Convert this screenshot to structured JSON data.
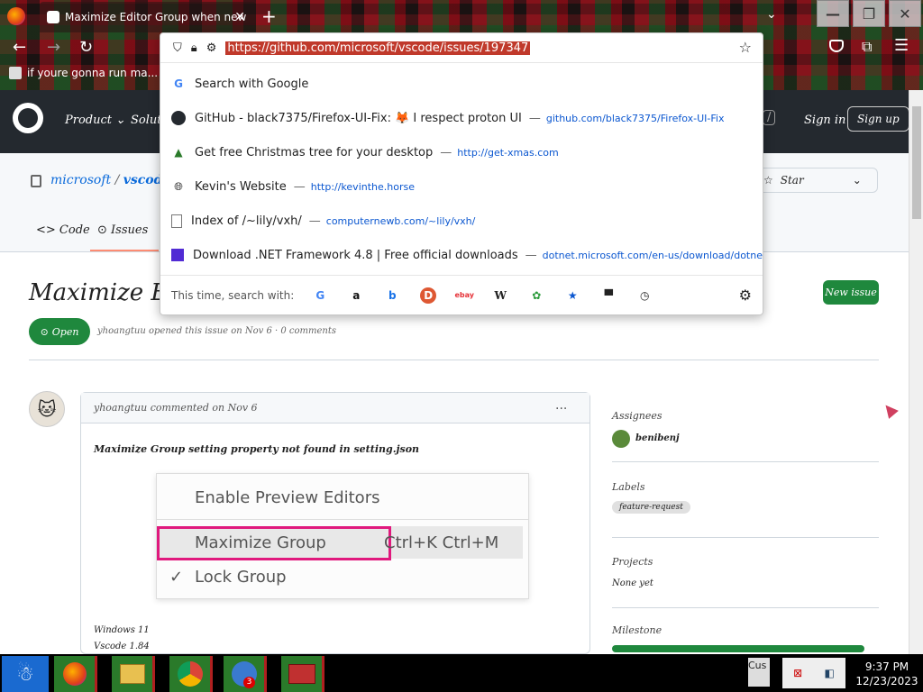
{
  "browser": {
    "tab_title": "Maximize Editor Group when new",
    "tab_close": "✕",
    "new_tab": "+",
    "url_full": "https://github.com/microsoft/vscode/issues/197347",
    "bookmark_label": "if youre gonna run ma...",
    "window_controls": [
      "—",
      "❐",
      "✕"
    ]
  },
  "urlbar_dropdown": {
    "suggestions": [
      {
        "title": "Search with Google",
        "url": "",
        "icon": "google-icon"
      },
      {
        "title": "GitHub - black7375/Firefox-UI-Fix: 🦊 I respect proton UI",
        "url": "github.com/black7375/Firefox-UI-Fix",
        "icon": "github-icon"
      },
      {
        "title": "Get free Christmas tree for your desktop",
        "url": "http://get-xmas.com",
        "icon": "tree-icon"
      },
      {
        "title": "Kevin's Website",
        "url": "http://kevinthe.horse",
        "icon": "globe-icon"
      },
      {
        "title": "Index of /~lily/vxh/",
        "url": "computernewb.com/~lily/vxh/",
        "icon": "page-icon"
      },
      {
        "title": "Download .NET Framework 4.8 | Free official downloads",
        "url": "dotnet.microsoft.com/en-us/download/dotnet-f",
        "icon": "dotnet-icon"
      }
    ],
    "search_label": "This time, search with:",
    "engines": [
      "G",
      "a",
      "b",
      "D",
      "ebay",
      "W",
      "✿",
      "★",
      "▀",
      "◷"
    ]
  },
  "github": {
    "nav": [
      "Product",
      "Solutions"
    ],
    "sign_in": "Sign in",
    "sign_up": "Sign up",
    "repo_owner": "microsoft",
    "repo_sep": "/",
    "repo_name": "vscode",
    "tab_code": "Code",
    "tab_issues": "Issues",
    "issue_title": "Maximize Editor",
    "new_issue": "New issue",
    "state": "Open",
    "meta": "yhoangtuu opened this issue on Nov 6 · 0 comments",
    "comment_author": "yhoangtuu commented on Nov 6",
    "comment_body": "Maximize Group setting property not found in setting.json",
    "menu_items": [
      "Enable Preview Editors",
      "Maximize Group",
      "Lock Group"
    ],
    "menu_shortcut": "Ctrl+K Ctrl+M",
    "check": "✓",
    "more": "···",
    "footer_lines": [
      "Windows 11",
      "Vscode 1.84"
    ],
    "sidebar": {
      "assignees_label": "Assignees",
      "assignee": "benibenj",
      "labels_label": "Labels",
      "label": "feature-request",
      "projects_label": "Projects",
      "projects_value": "None yet",
      "milestone_label": "Milestone"
    }
  },
  "taskbar": {
    "time": "9:37 PM",
    "date": "12/23/2023",
    "cus": "Cus",
    "badge": "3"
  }
}
